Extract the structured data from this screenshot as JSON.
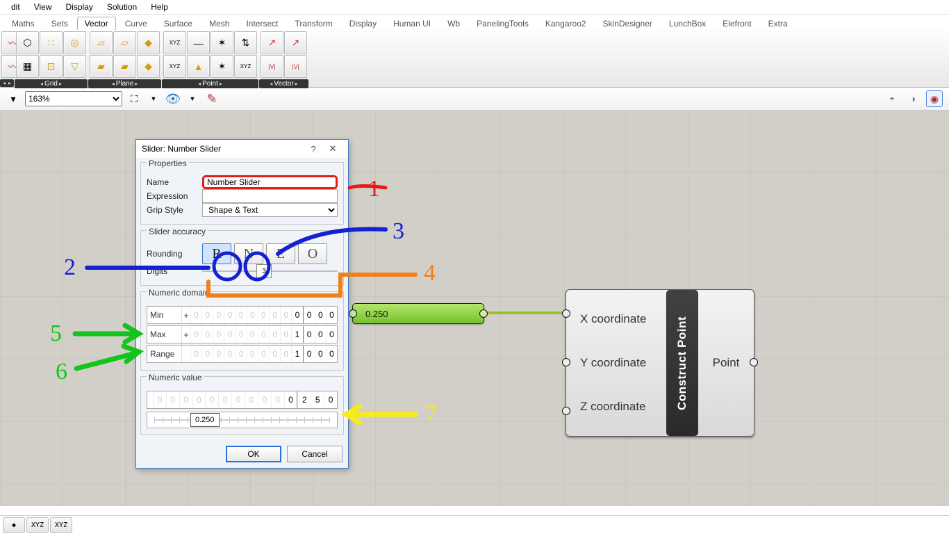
{
  "menu": [
    "dit",
    "View",
    "Display",
    "Solution",
    "Help"
  ],
  "tabs": [
    "Maths",
    "Sets",
    "Vector",
    "Curve",
    "Surface",
    "Mesh",
    "Intersect",
    "Transform",
    "Display",
    "Human UI",
    "Wb",
    "PanelingTools",
    "Kangaroo2",
    "SkinDesigner",
    "LunchBox",
    "Elefront",
    "Extra"
  ],
  "active_tab": "Vector",
  "ribbon_panels": [
    "",
    "Grid",
    "Plane",
    "Point",
    "Vector"
  ],
  "zoom": "163%",
  "canvas_slider_value": "0.250",
  "component": {
    "name": "Construct Point",
    "inputs": [
      "X coordinate",
      "Y coordinate",
      "Z coordinate"
    ],
    "output": "Point"
  },
  "dialog": {
    "title": "Slider: Number Slider",
    "properties_title": "Properties",
    "name_label": "Name",
    "name_value": "Number Slider",
    "expression_label": "Expression",
    "expression_value": "",
    "grip_label": "Grip Style",
    "grip_value": "Shape & Text",
    "accuracy_title": "Slider accuracy",
    "rounding_label": "Rounding",
    "rounding_opts": [
      "R",
      "N",
      "E",
      "O"
    ],
    "rounding_selected": "R",
    "digits_label": "Digits",
    "digits_value": "3",
    "domain_title": "Numeric domain",
    "min_label": "Min",
    "min_int": "0",
    "min_dec": "000",
    "max_label": "Max",
    "max_int": "1",
    "max_dec": "000",
    "range_label": "Range",
    "range_int": "1",
    "range_dec": "000",
    "value_title": "Numeric value",
    "value_int": "0",
    "value_dec": "250",
    "value_track": "0.250",
    "ok": "OK",
    "cancel": "Cancel",
    "help": "?",
    "close": "✕"
  },
  "annotations": {
    "a1": "1",
    "a2": "2",
    "a3": "3",
    "a4": "4",
    "a5": "5",
    "a6": "6",
    "a7": "7"
  },
  "status_icons": [
    "◆",
    "XYZ",
    "XYZ"
  ]
}
